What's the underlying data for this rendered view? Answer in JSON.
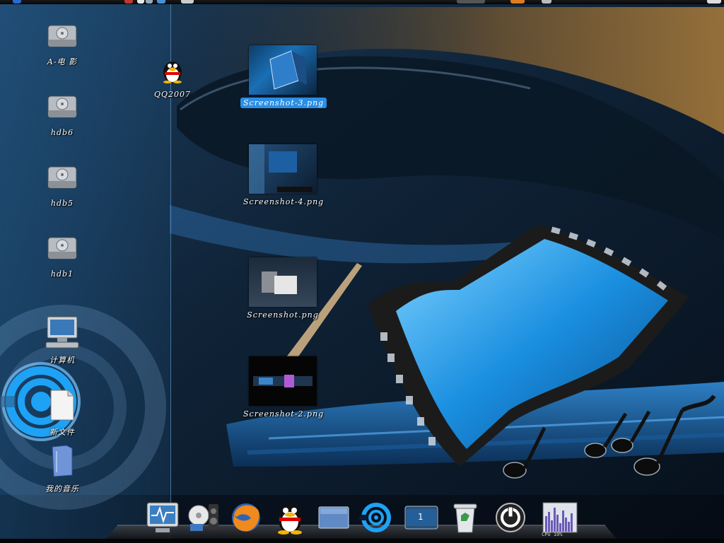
{
  "desktop": {
    "icons": [
      {
        "label": "A-电 影",
        "icon": "hard-drive-icon"
      },
      {
        "label": "hdb6",
        "icon": "hard-drive-icon"
      },
      {
        "label": "hdb5",
        "icon": "hard-drive-icon"
      },
      {
        "label": "hdb1",
        "icon": "hard-drive-icon"
      },
      {
        "label": "计算机",
        "icon": "computer-icon"
      },
      {
        "label": "新文件",
        "icon": "new-file-icon"
      },
      {
        "label": "我的音乐",
        "icon": "music-folder-icon"
      },
      {
        "label": "QQ2007",
        "icon": "qq-penguin-icon"
      }
    ],
    "files": [
      {
        "label": "Screenshot-3.png",
        "selected": true
      },
      {
        "label": "Screenshot-4.png",
        "selected": false
      },
      {
        "label": "Screenshot.png",
        "selected": false
      },
      {
        "label": "Screenshot-2.png",
        "selected": false
      }
    ]
  },
  "dock": {
    "items": [
      "system-monitor-icon",
      "media-player-icon",
      "firefox-icon",
      "qq-penguin-icon",
      "show-desktop-icon",
      "menu-ring-icon",
      "workspace-switcher-icon",
      "trash-icon",
      "power-icon",
      "cpu-graph-icon"
    ],
    "workspace_number": "1",
    "cpu_label": "CPU 10%"
  },
  "colors": {
    "selection": "#2a8ee6",
    "accent": "#1e9bf0"
  }
}
